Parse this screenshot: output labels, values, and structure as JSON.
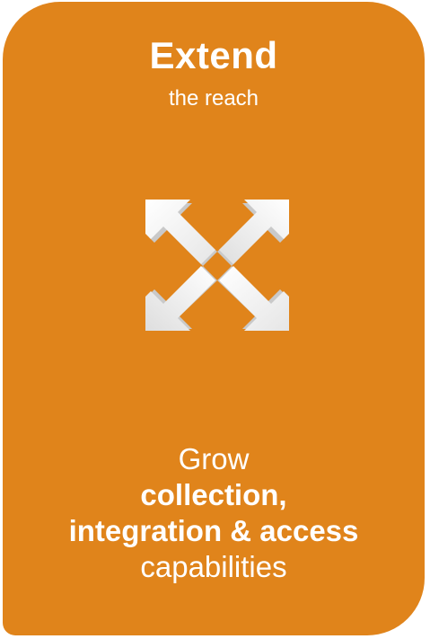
{
  "card": {
    "background": "#e0841b",
    "title": "Extend",
    "subtitle": "the reach",
    "icon": "expand-arrows-icon",
    "tagline": {
      "line1": "Grow",
      "line2": "collection,",
      "line3": "integration & access",
      "line4": "capabilities"
    }
  }
}
